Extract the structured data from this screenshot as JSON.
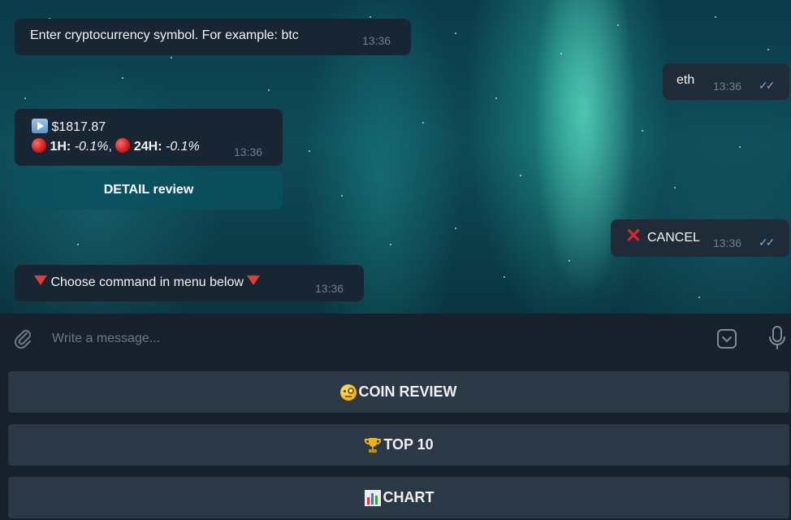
{
  "messages": {
    "m1": {
      "text": "Enter cryptocurrency symbol. For example: btc",
      "time": "13:36"
    },
    "m2": {
      "text": "eth",
      "time": "13:36"
    },
    "m3": {
      "price": "$1817.87",
      "h1_label": "1H:",
      "h1_value": "-0.1%",
      "sep": ",",
      "h24_label": "24H:",
      "h24_value": "-0.1%",
      "time": "13:36"
    },
    "inline_button": {
      "label": "DETAIL review"
    },
    "m4": {
      "text": "CANCEL",
      "time": "13:36"
    },
    "m5": {
      "text": "Choose command in menu below",
      "time": "13:36"
    }
  },
  "composer": {
    "placeholder": "Write a message..."
  },
  "menu": {
    "buttons": [
      {
        "label": "COIN REVIEW",
        "icon": "monocle-face-emoji"
      },
      {
        "label": "TOP 10",
        "icon": "trophy-emoji"
      },
      {
        "label": "CHART",
        "icon": "bar-chart-emoji"
      }
    ]
  },
  "colors": {
    "bubble_bg": "#182533",
    "menu_button_bg": "#2b3947",
    "composer_bg": "#17212b",
    "timestamp": "#6d7f8f",
    "read_checks": "#7aa7d9",
    "negative_dot": "#d01c1c"
  }
}
